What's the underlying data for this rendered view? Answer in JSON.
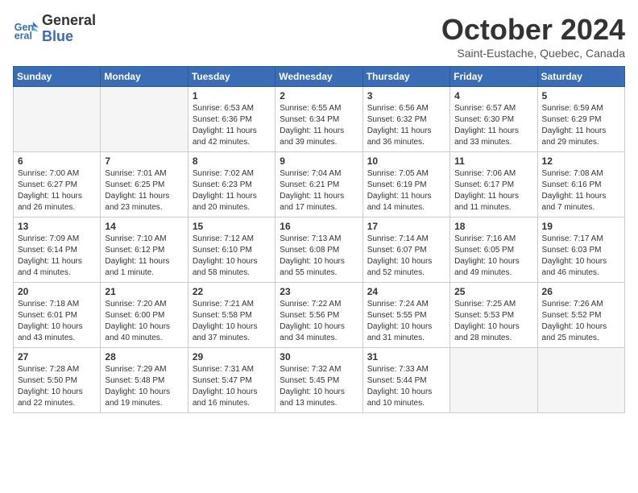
{
  "logo": {
    "line1": "General",
    "line2": "Blue"
  },
  "title": "October 2024",
  "subtitle": "Saint-Eustache, Quebec, Canada",
  "headers": [
    "Sunday",
    "Monday",
    "Tuesday",
    "Wednesday",
    "Thursday",
    "Friday",
    "Saturday"
  ],
  "weeks": [
    [
      {
        "day": "",
        "empty": true
      },
      {
        "day": "",
        "empty": true
      },
      {
        "day": "1",
        "sunrise": "6:53 AM",
        "sunset": "6:36 PM",
        "daylight": "11 hours and 42 minutes."
      },
      {
        "day": "2",
        "sunrise": "6:55 AM",
        "sunset": "6:34 PM",
        "daylight": "11 hours and 39 minutes."
      },
      {
        "day": "3",
        "sunrise": "6:56 AM",
        "sunset": "6:32 PM",
        "daylight": "11 hours and 36 minutes."
      },
      {
        "day": "4",
        "sunrise": "6:57 AM",
        "sunset": "6:30 PM",
        "daylight": "11 hours and 33 minutes."
      },
      {
        "day": "5",
        "sunrise": "6:59 AM",
        "sunset": "6:29 PM",
        "daylight": "11 hours and 29 minutes."
      }
    ],
    [
      {
        "day": "6",
        "sunrise": "7:00 AM",
        "sunset": "6:27 PM",
        "daylight": "11 hours and 26 minutes."
      },
      {
        "day": "7",
        "sunrise": "7:01 AM",
        "sunset": "6:25 PM",
        "daylight": "11 hours and 23 minutes."
      },
      {
        "day": "8",
        "sunrise": "7:02 AM",
        "sunset": "6:23 PM",
        "daylight": "11 hours and 20 minutes."
      },
      {
        "day": "9",
        "sunrise": "7:04 AM",
        "sunset": "6:21 PM",
        "daylight": "11 hours and 17 minutes."
      },
      {
        "day": "10",
        "sunrise": "7:05 AM",
        "sunset": "6:19 PM",
        "daylight": "11 hours and 14 minutes."
      },
      {
        "day": "11",
        "sunrise": "7:06 AM",
        "sunset": "6:17 PM",
        "daylight": "11 hours and 11 minutes."
      },
      {
        "day": "12",
        "sunrise": "7:08 AM",
        "sunset": "6:16 PM",
        "daylight": "11 hours and 7 minutes."
      }
    ],
    [
      {
        "day": "13",
        "sunrise": "7:09 AM",
        "sunset": "6:14 PM",
        "daylight": "11 hours and 4 minutes."
      },
      {
        "day": "14",
        "sunrise": "7:10 AM",
        "sunset": "6:12 PM",
        "daylight": "11 hours and 1 minute."
      },
      {
        "day": "15",
        "sunrise": "7:12 AM",
        "sunset": "6:10 PM",
        "daylight": "10 hours and 58 minutes."
      },
      {
        "day": "16",
        "sunrise": "7:13 AM",
        "sunset": "6:08 PM",
        "daylight": "10 hours and 55 minutes."
      },
      {
        "day": "17",
        "sunrise": "7:14 AM",
        "sunset": "6:07 PM",
        "daylight": "10 hours and 52 minutes."
      },
      {
        "day": "18",
        "sunrise": "7:16 AM",
        "sunset": "6:05 PM",
        "daylight": "10 hours and 49 minutes."
      },
      {
        "day": "19",
        "sunrise": "7:17 AM",
        "sunset": "6:03 PM",
        "daylight": "10 hours and 46 minutes."
      }
    ],
    [
      {
        "day": "20",
        "sunrise": "7:18 AM",
        "sunset": "6:01 PM",
        "daylight": "10 hours and 43 minutes."
      },
      {
        "day": "21",
        "sunrise": "7:20 AM",
        "sunset": "6:00 PM",
        "daylight": "10 hours and 40 minutes."
      },
      {
        "day": "22",
        "sunrise": "7:21 AM",
        "sunset": "5:58 PM",
        "daylight": "10 hours and 37 minutes."
      },
      {
        "day": "23",
        "sunrise": "7:22 AM",
        "sunset": "5:56 PM",
        "daylight": "10 hours and 34 minutes."
      },
      {
        "day": "24",
        "sunrise": "7:24 AM",
        "sunset": "5:55 PM",
        "daylight": "10 hours and 31 minutes."
      },
      {
        "day": "25",
        "sunrise": "7:25 AM",
        "sunset": "5:53 PM",
        "daylight": "10 hours and 28 minutes."
      },
      {
        "day": "26",
        "sunrise": "7:26 AM",
        "sunset": "5:52 PM",
        "daylight": "10 hours and 25 minutes."
      }
    ],
    [
      {
        "day": "27",
        "sunrise": "7:28 AM",
        "sunset": "5:50 PM",
        "daylight": "10 hours and 22 minutes."
      },
      {
        "day": "28",
        "sunrise": "7:29 AM",
        "sunset": "5:48 PM",
        "daylight": "10 hours and 19 minutes."
      },
      {
        "day": "29",
        "sunrise": "7:31 AM",
        "sunset": "5:47 PM",
        "daylight": "10 hours and 16 minutes."
      },
      {
        "day": "30",
        "sunrise": "7:32 AM",
        "sunset": "5:45 PM",
        "daylight": "10 hours and 13 minutes."
      },
      {
        "day": "31",
        "sunrise": "7:33 AM",
        "sunset": "5:44 PM",
        "daylight": "10 hours and 10 minutes."
      },
      {
        "day": "",
        "empty": true
      },
      {
        "day": "",
        "empty": true
      }
    ]
  ]
}
